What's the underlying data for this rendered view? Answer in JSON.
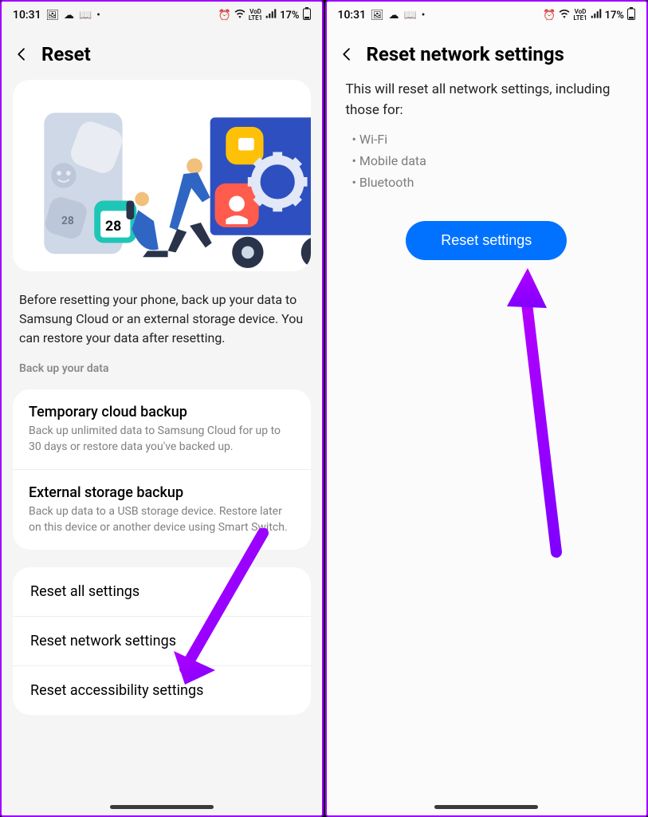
{
  "status": {
    "time": "10:31",
    "battery_pct": "17%",
    "lte1": "VoD",
    "lte2": "LTE1"
  },
  "left": {
    "header": {
      "title": "Reset"
    },
    "description": "Before resetting your phone, back up your data to Samsung Cloud or an external storage device. You can restore your data after resetting.",
    "backup_label": "Back up your data",
    "backup_items": [
      {
        "title": "Temporary cloud backup",
        "sub": "Back up unlimited data to Samsung Cloud for up to 30 days or restore data you've backed up."
      },
      {
        "title": "External storage backup",
        "sub": "Back up data to a USB storage device. Restore later on this device or another device using Smart Switch."
      }
    ],
    "reset_items": [
      {
        "title": "Reset all settings"
      },
      {
        "title": "Reset network settings"
      },
      {
        "title": "Reset accessibility settings"
      }
    ],
    "illus_day": "28"
  },
  "right": {
    "header": {
      "title": "Reset network settings"
    },
    "description": "This will reset all network settings, including those for:",
    "bullets": [
      "Wi-Fi",
      "Mobile data",
      "Bluetooth"
    ],
    "button": "Reset settings"
  },
  "colors": {
    "accent": "#0072ff",
    "arrow": "#9b00ff"
  }
}
